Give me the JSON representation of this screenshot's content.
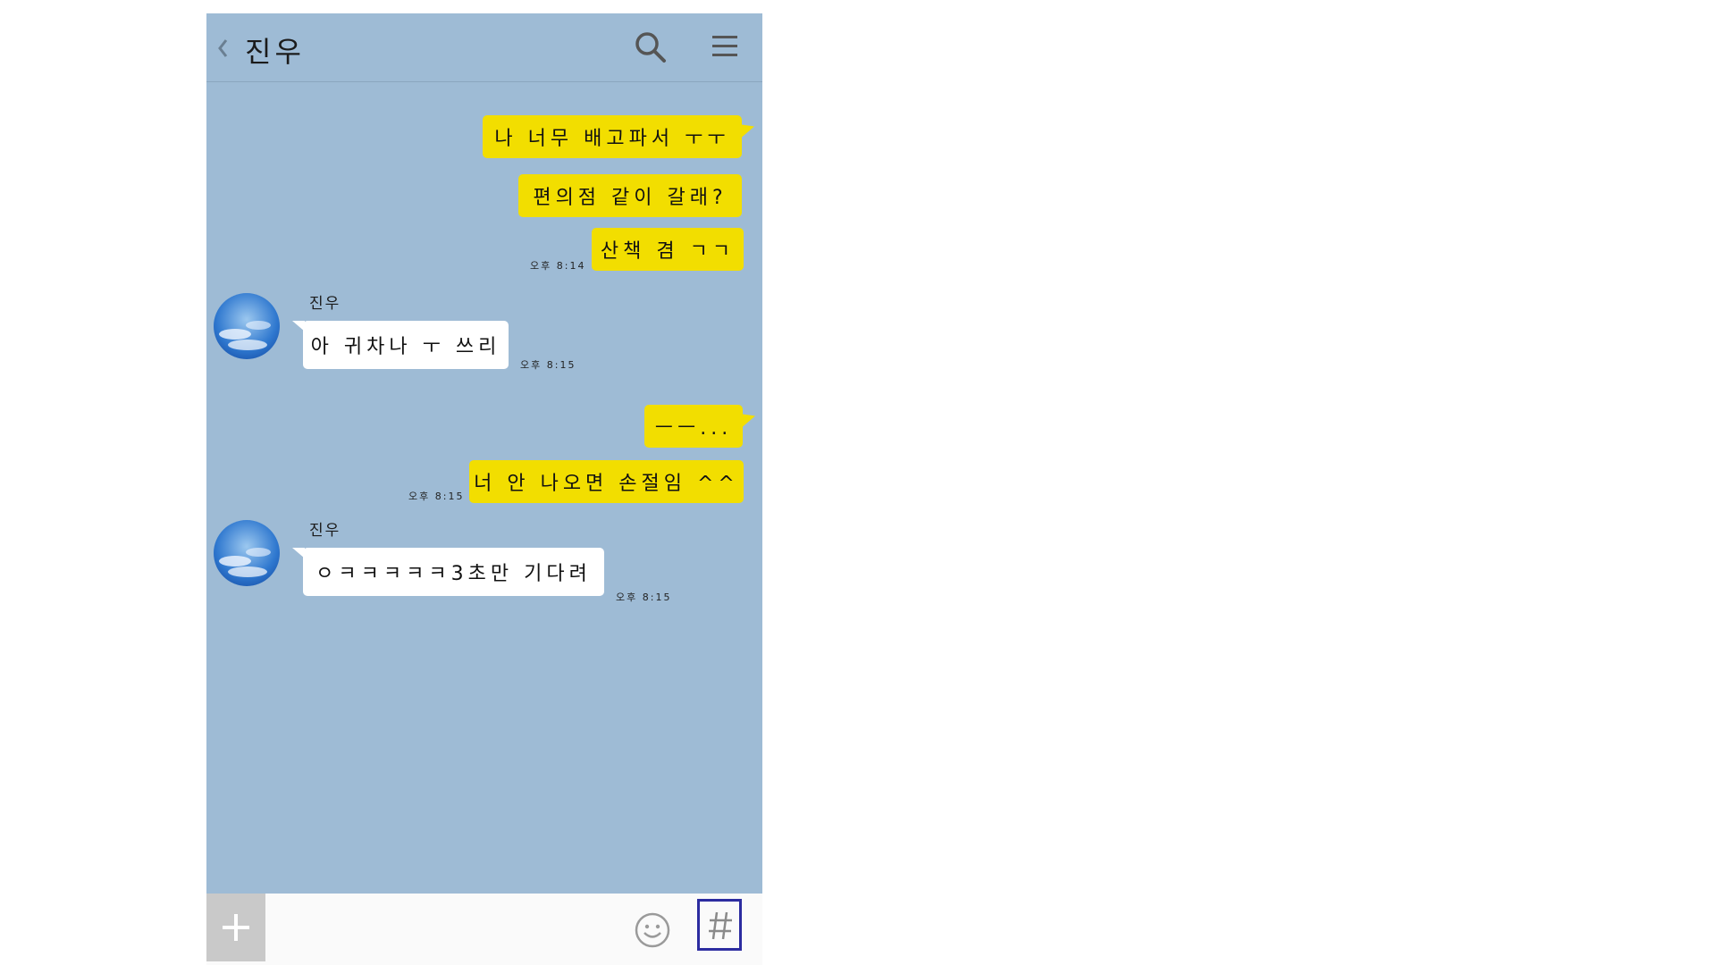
{
  "header": {
    "title": "진우"
  },
  "messages": [
    {
      "side": "mine",
      "text": "나 너무 배고파서 ㅜㅜ"
    },
    {
      "side": "mine",
      "text": "편의점 같이 갈래?"
    },
    {
      "side": "mine",
      "text": "산책 겸 ㄱㄱ",
      "time": "오후 8:14"
    },
    {
      "side": "theirs",
      "sender": "진우",
      "text": "아 귀차나 ㅜ 쓰리",
      "time": "오후 8:15"
    },
    {
      "side": "mine",
      "text": "ㅡㅡ..."
    },
    {
      "side": "mine",
      "text": "너 안 나오면 손절임 ^^",
      "time": "오후 8:15"
    },
    {
      "side": "theirs",
      "sender": "진우",
      "text": "ㅇㅋㅋㅋㅋㅋ3초만 기다려",
      "time": "오후 8:15"
    }
  ],
  "colors": {
    "chat_background": "#9ebbd5",
    "my_bubble": "#f2de00",
    "their_bubble": "#ffffff",
    "selection_border": "#2c2ca0"
  },
  "icons": {
    "back": "chevron-left-icon",
    "search": "search-icon",
    "menu": "hamburger-menu-icon",
    "attach": "plus-icon",
    "emoji": "smiley-icon",
    "hashtag": "hashtag-icon"
  }
}
